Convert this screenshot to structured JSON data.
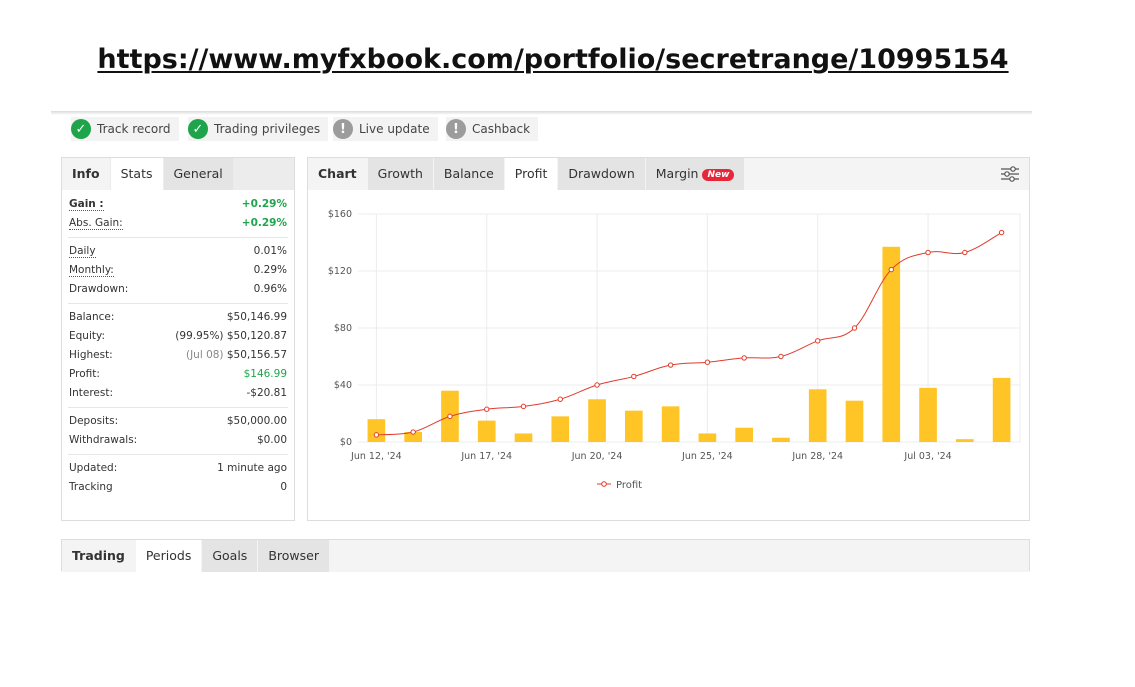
{
  "url": "https://www.myfxbook.com/portfolio/secretrange/10995154",
  "badges": [
    {
      "label": "Track record",
      "state": "ok",
      "icon": "check-icon"
    },
    {
      "label": "Trading privileges",
      "state": "ok",
      "icon": "check-icon"
    },
    {
      "label": "Live update",
      "state": "warn",
      "icon": "exclamation-icon"
    },
    {
      "label": "Cashback",
      "state": "warn",
      "icon": "exclamation-icon"
    }
  ],
  "left_tabs": [
    "Info",
    "Stats",
    "General"
  ],
  "stats": {
    "gain_label": "Gain :",
    "gain_value": "+0.29%",
    "abs_gain_label": "Abs. Gain:",
    "abs_gain_value": "+0.29%",
    "daily_label": "Daily",
    "daily_value": "0.01%",
    "monthly_label": "Monthly:",
    "monthly_value": "0.29%",
    "drawdown_label": "Drawdown:",
    "drawdown_value": "0.96%",
    "balance_label": "Balance:",
    "balance_value": "$50,146.99",
    "equity_label": "Equity:",
    "equity_sub": "(99.95%)",
    "equity_value": "$50,120.87",
    "highest_label": "Highest:",
    "highest_sub": "(Jul 08)",
    "highest_value": "$50,156.57",
    "profit_label": "Profit:",
    "profit_value": "$146.99",
    "interest_label": "Interest:",
    "interest_value": "-$20.81",
    "deposits_label": "Deposits:",
    "deposits_value": "$50,000.00",
    "withdrawals_label": "Withdrawals:",
    "withdrawals_value": "$0.00",
    "updated_label": "Updated:",
    "updated_value": "1 minute ago",
    "tracking_label": "Tracking",
    "tracking_value": "0"
  },
  "chart_tabs": {
    "chart": "Chart",
    "growth": "Growth",
    "balance": "Balance",
    "profit": "Profit",
    "drawdown": "Drawdown",
    "margin": "Margin",
    "new_badge": "New"
  },
  "bottom_tabs": [
    "Trading",
    "Periods",
    "Goals",
    "Browser"
  ],
  "colors": {
    "bar": "#ffc526",
    "line": "#e03b2e",
    "green": "#1ea54c"
  },
  "chart_data": {
    "type": "bar",
    "title": "",
    "ylabel": "",
    "ylim": [
      0,
      160
    ],
    "y_ticks": [
      "$0",
      "$40",
      "$80",
      "$120",
      "$160"
    ],
    "y_tick_values": [
      0,
      40,
      80,
      120,
      160
    ],
    "x_tick_labels": [
      "Jun 12, '24",
      "Jun 17, '24",
      "Jun 20, '24",
      "Jun 25, '24",
      "Jun 28, '24",
      "Jul 03, '24"
    ],
    "x_tick_index": [
      0,
      3,
      6,
      9,
      12,
      15
    ],
    "bars": [
      16,
      7,
      36,
      15,
      6,
      18,
      30,
      22,
      25,
      6,
      10,
      3,
      37,
      29,
      137,
      38,
      2,
      45
    ],
    "series": [
      {
        "name": "Profit",
        "values": [
          5,
          7,
          18,
          23,
          25,
          30,
          40,
          46,
          54,
          56,
          59,
          60,
          71,
          80,
          121,
          133,
          133,
          147
        ]
      }
    ],
    "legend": "bottom-center"
  }
}
